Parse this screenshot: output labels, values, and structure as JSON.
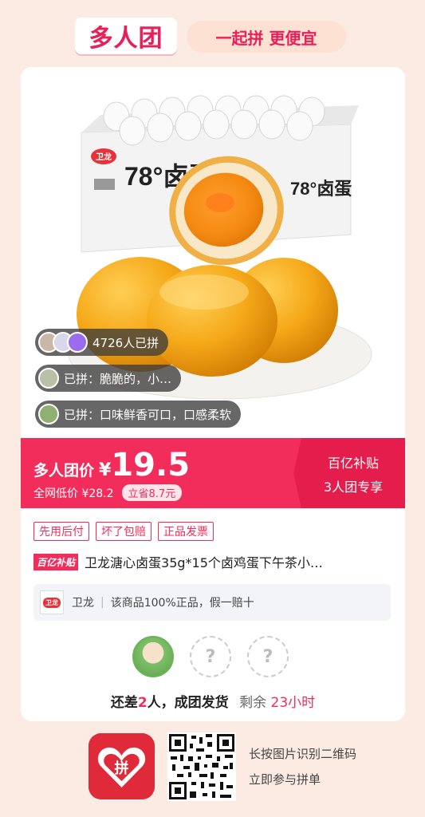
{
  "header": {
    "logo_text": "多人团",
    "slogan": "一起拼 更便宜"
  },
  "product_image": {
    "box_brand": "卫龙",
    "box_title": "78°卤蛋",
    "badges": [
      {
        "text": "4726人已拼"
      },
      {
        "text": "已拼：脆脆的，小…"
      },
      {
        "text": "已拼：口味鲜香可口，口感柔软"
      }
    ]
  },
  "price": {
    "label": "多人团价",
    "currency": "¥",
    "value": "19.5",
    "original_label": "全网低价 ¥28.2",
    "save_tag": "立省8.7元",
    "side_line1": "百亿补贴",
    "side_line2": "3人团专享"
  },
  "tags": [
    "先用后付",
    "坏了包赔",
    "正品发票"
  ],
  "product": {
    "subsidy_badge": "百亿补贴",
    "title": "卫龙溏心卤蛋35g*15个卤鸡蛋下午茶小…"
  },
  "brand": {
    "logo_text": "卫龙",
    "name": "卫龙",
    "guarantee": "该商品100%正品，假一赔十"
  },
  "group": {
    "empty_slot_symbol": "?",
    "status_prefix": "还差",
    "remaining_people": "2",
    "status_suffix": "人，成团发货",
    "time_label": "剩余",
    "time_value": "23小时"
  },
  "footer": {
    "app_icon_text": "拼",
    "hint_line1": "长按图片识别二维码",
    "hint_line2": "立即参与拼单"
  },
  "colors": {
    "accent": "#f22d5b",
    "background": "#fcebe3"
  }
}
